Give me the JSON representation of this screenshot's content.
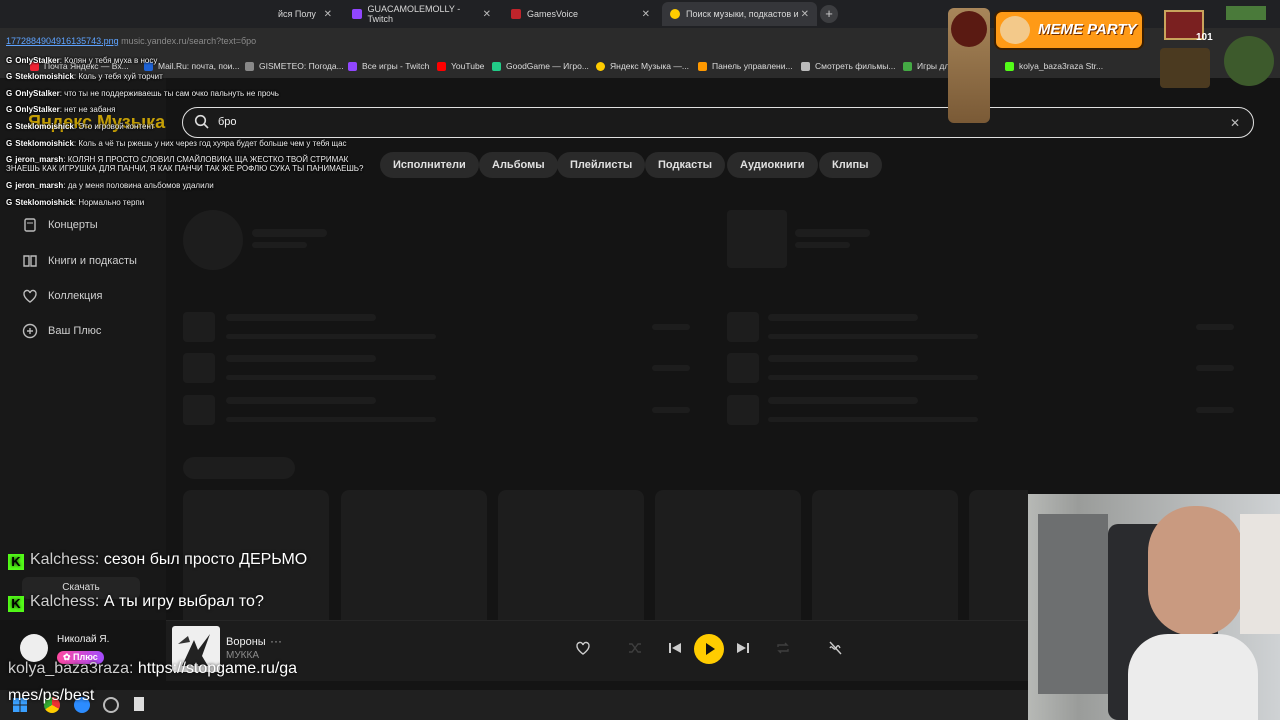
{
  "browser": {
    "tabs": [
      {
        "label": "йся Полу",
        "active": false
      },
      {
        "label": "GUACAMOLEMOLLY - Twitch",
        "active": false
      },
      {
        "label": "GamesVoice",
        "active": false
      },
      {
        "label": "Поиск музыки, подкастов и ау",
        "active": true
      }
    ],
    "url": "music.yandex.ru/search?text=бро",
    "overlay_number": "1772884904916135743.png",
    "bookmarks": [
      "Почта Яндекс — Вх...",
      "Mail.Ru: почта, пои...",
      "GISMETEO: Погода...",
      "Все игры - Twitch",
      "YouTube",
      "GoodGame — Игро...",
      "Яндекс Музыка —...",
      "Панель управлени...",
      "Смотреть фильмы...",
      "Игры для",
      "kolya_baza3raza Str..."
    ]
  },
  "app": {
    "logo": "Яндекс Музыка",
    "sidebar": [
      {
        "label": "Концерты",
        "icon": "ticket-icon"
      },
      {
        "label": "Книги и подкасты",
        "icon": "book-icon"
      },
      {
        "label": "Коллекция",
        "icon": "heart-icon"
      },
      {
        "label": "Ваш Плюс",
        "icon": "plus-icon"
      }
    ],
    "download_label": "Скачать",
    "search": {
      "value": "бро"
    },
    "filters": [
      "Исполнители",
      "Альбомы",
      "Плейлисты",
      "Подкасты",
      "Аудиокниги",
      "Клипы"
    ],
    "user": {
      "name": "Николай Я.",
      "badge": "Плюс"
    },
    "player": {
      "title": "Вороны",
      "artist": "МУККА",
      "more": "···"
    }
  },
  "chat_small": [
    {
      "user": "OnlyStalker",
      "text": "Колян у тебя муха в носу"
    },
    {
      "user": "Steklomoishick",
      "text": "Коль у тебя хуй торчит"
    },
    {
      "user": "OnlyStalker",
      "text": "что ты не поддерживаешь ты сам очко пальнуть не прочь"
    },
    {
      "user": "OnlyStalker",
      "text": "нет не забаня"
    },
    {
      "user": "Steklomoishick",
      "text": "Это игровой контент"
    },
    {
      "user": "Steklomoishick",
      "text": "Коль а чё ты ржешь у них через год хуяра будет больше чем у тебя щас"
    },
    {
      "user": "jeron_marsh",
      "text": "КОЛЯН Я ПРОСТО СЛОВИЛ СМАЙЛОВИКА ЩА ЖЕСТКО ТВОЙ СТРИМАК"
    },
    {
      "user": "",
      "text": "ЗНАЕШЬ КАК ИГРУШКА ДЛЯ ПАНЧИ, Я КАК ПАНЧИ ТАК ЖЕ РОФЛЮ СУКА ТЫ ПАНИМАЕШЬ?"
    },
    {
      "user": "jeron_marsh",
      "text": "да у меня половина альбомов удалили"
    },
    {
      "user": "Steklomoishick",
      "text": "Нормально терпи"
    }
  ],
  "chat_big": [
    {
      "user": "Kalchess:",
      "text": "сезон был просто ДЕРЬМО"
    },
    {
      "user": "Kalchess:",
      "text": "А ты игру выбрал то?"
    },
    {
      "user": "kolya_baza3raza:",
      "text": "https://stopgame.ru/ga"
    },
    {
      "user": "",
      "text": "mes/ps/best"
    }
  ],
  "overlay": {
    "meme_party": "MEME PARTY",
    "counter": "101"
  }
}
